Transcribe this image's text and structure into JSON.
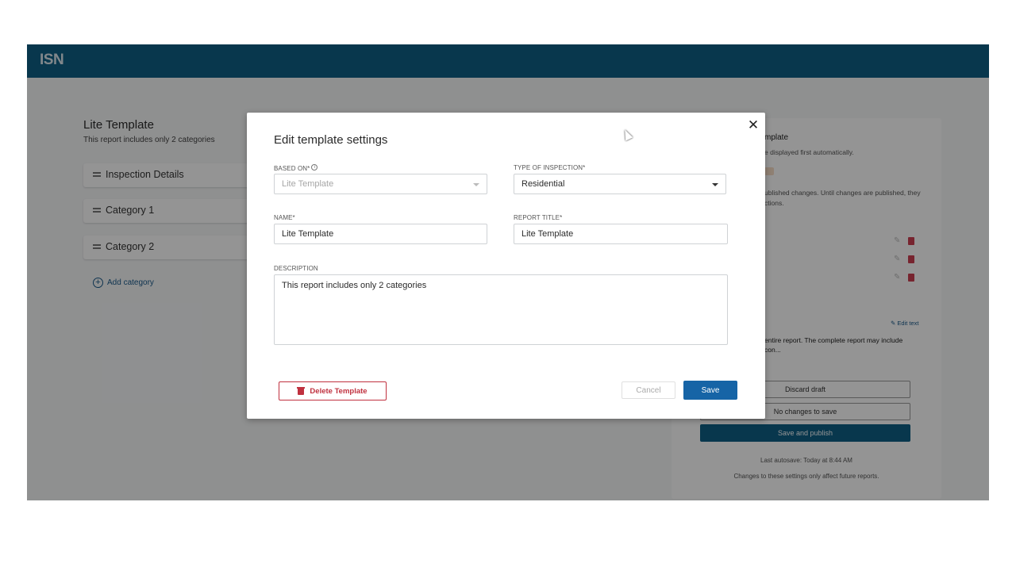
{
  "app": {
    "logo": "ISN"
  },
  "left_panel": {
    "title": "Lite Template",
    "subtitle": "This report includes only 2 categories",
    "categories": [
      "Inspection Details",
      "Category 1",
      "Category 2"
    ],
    "add_category": "Add category"
  },
  "right_panel": {
    "title_fragment": "mplate",
    "line1": "e displayed first automatically.",
    "line2": "ublished changes. Until changes are published, they",
    "line3": "ctions.",
    "edit_text": "Edit text",
    "bold_line1": "entire report. The complete report may include",
    "bold_line2": "con...",
    "discard_draft": "Discard draft",
    "no_changes": "No changes to save",
    "save_publish": "Save and publish",
    "last_autosave": "Last autosave: Today at 8:44 AM",
    "note": "Changes to these settings only affect future reports."
  },
  "modal": {
    "title": "Edit template settings",
    "based_on_label": "BASED ON*",
    "based_on_value": "Lite Template",
    "type_label": "TYPE OF INSPECTION*",
    "type_value": "Residential",
    "name_label": "NAME*",
    "name_value": "Lite Template",
    "report_title_label": "REPORT TITLE*",
    "report_title_value": "Lite Template",
    "description_label": "DESCRIPTION",
    "description_value": "This report includes only 2 categories",
    "delete_label": "Delete Template",
    "cancel_label": "Cancel",
    "save_label": "Save"
  },
  "colors": {
    "brand": "#0e5f86",
    "primary_button": "#1664a6",
    "danger": "#c0313f"
  },
  "icons": [
    "close-icon",
    "info-icon",
    "chevron-down-icon",
    "trash-icon",
    "plus-circle-icon",
    "drag-handle-icon",
    "pencil-icon"
  ]
}
